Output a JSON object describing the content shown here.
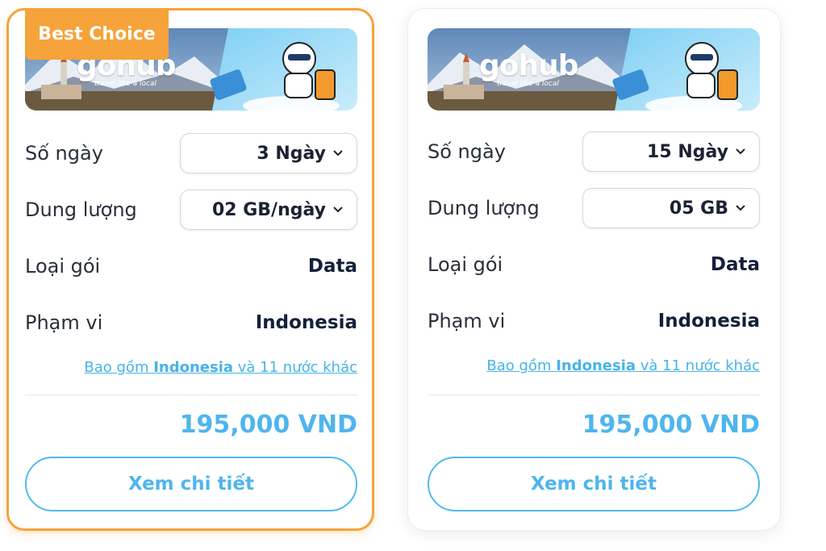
{
  "cards": [
    {
      "badge": "Best Choice",
      "brand": {
        "logo": "gohub",
        "tagline": "travel like a local"
      },
      "days": {
        "label": "Số ngày",
        "value": "3 Ngày"
      },
      "data_amount": {
        "label": "Dung lượng",
        "value": "02 GB/ngày"
      },
      "package_type": {
        "label": "Loại gói",
        "value": "Data"
      },
      "coverage": {
        "label": "Phạm vi",
        "value": "Indonesia"
      },
      "include": {
        "prefix": "Bao gồm ",
        "country": "Indonesia",
        "suffix": " và 11 nước khác"
      },
      "price": "195,000 VND",
      "cta": "Xem chi tiết"
    },
    {
      "brand": {
        "logo": "gohub",
        "tagline": "travel like a local"
      },
      "days": {
        "label": "Số ngày",
        "value": "15 Ngày"
      },
      "data_amount": {
        "label": "Dung lượng",
        "value": "05 GB"
      },
      "package_type": {
        "label": "Loại gói",
        "value": "Data"
      },
      "coverage": {
        "label": "Phạm vi",
        "value": "Indonesia"
      },
      "include": {
        "prefix": "Bao gồm ",
        "country": "Indonesia",
        "suffix": " và 11 nước khác"
      },
      "price": "195,000 VND",
      "cta": "Xem chi tiết"
    }
  ],
  "colors": {
    "accent_orange": "#f5a33a",
    "price_blue": "#4fb5ee",
    "link_blue": "#47b3e8",
    "value_dark": "#13203a"
  },
  "icons": [
    "chevron-down-icon",
    "mascot-icon",
    "esim-card-icon"
  ]
}
